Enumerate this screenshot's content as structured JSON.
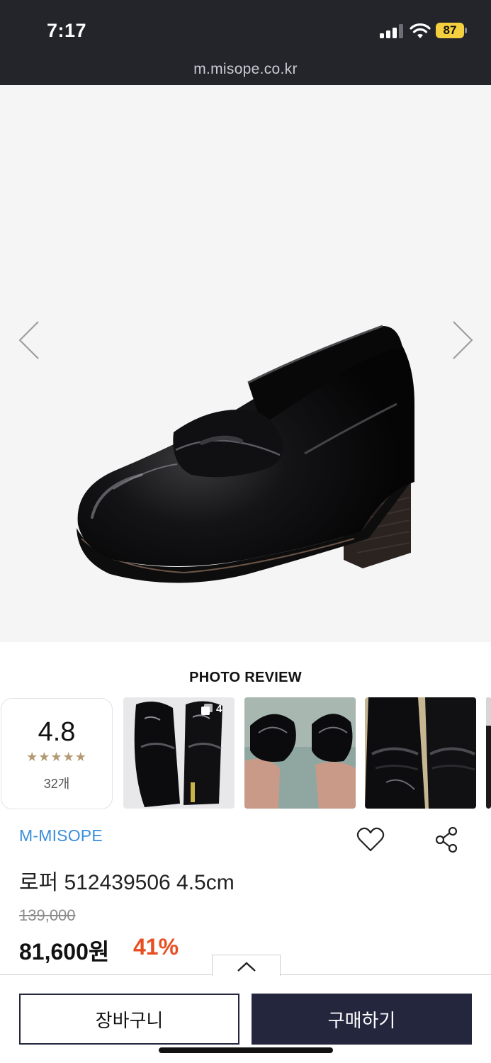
{
  "status_bar": {
    "time": "7:17",
    "battery": "87",
    "url": "m.misope.co.kr"
  },
  "gallery": {
    "prev_icon": "chevron-left-icon",
    "next_icon": "chevron-right-icon",
    "image_alt": "black patent penny loafer"
  },
  "photo_review": {
    "title": "PHOTO REVIEW",
    "rating": "4.8",
    "stars": "★★★★★",
    "count": "32개",
    "first_photo_count": "4"
  },
  "product": {
    "brand": "M-MISOPE",
    "name": "로퍼 512439506 4.5cm",
    "original_price": "139,000",
    "sale_price": "81,600원",
    "discount": "41%"
  },
  "actions": {
    "cart_label": "장바구니",
    "buy_label": "구매하기",
    "toggle_icon": "chevron-up-icon"
  },
  "colors": {
    "status_bg": "#23252b",
    "brand": "#3a8edb",
    "discount": "#e94e23",
    "buy_bg": "#23263d",
    "star": "#b49a72"
  }
}
